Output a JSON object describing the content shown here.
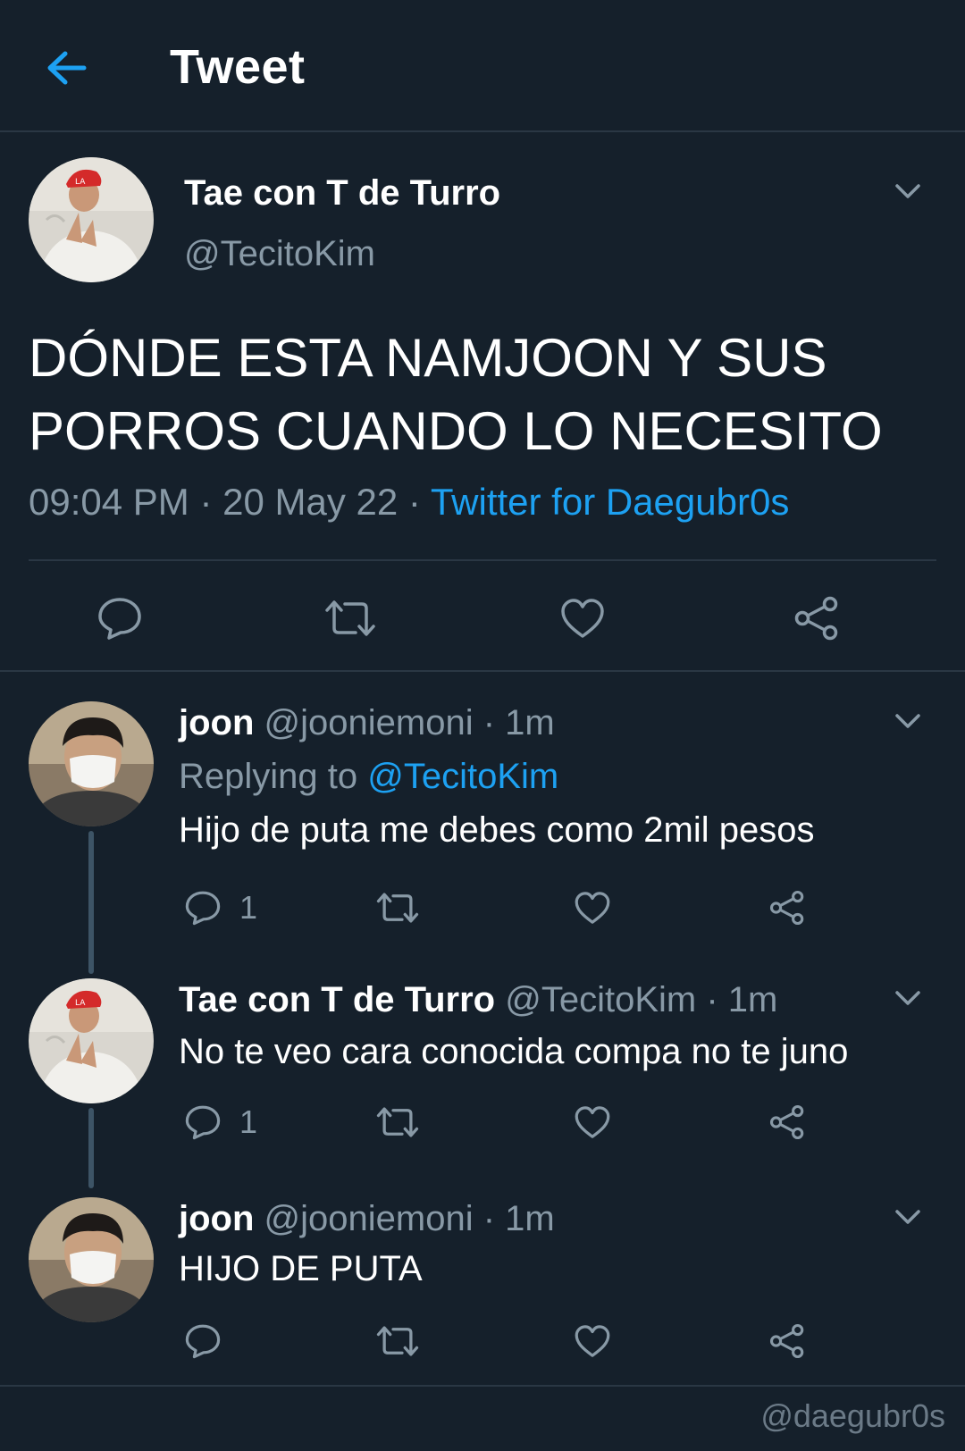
{
  "header": {
    "title": "Tweet"
  },
  "main_tweet": {
    "name": "Tae con T de Turro",
    "handle": "@TecitoKim",
    "text_line1": "DÓNDE ESTA NAMJOON Y SUS",
    "text_line2": "PORROS CUANDO LO NECESITO",
    "time": "09:04 PM",
    "sep1": " · ",
    "date": "20 May 22",
    "sep2": " · ",
    "source": "Twitter for Daegubr0s"
  },
  "replies": [
    {
      "name": "joon",
      "handle": "@jooniemoni",
      "sep": " · ",
      "time": "1m",
      "replying_label": "Replying to ",
      "replying_to": "@TecitoKim",
      "text": "Hijo de puta me debes como 2mil pesos",
      "reply_count": "1"
    },
    {
      "name": "Tae con T de Turro",
      "handle": "@TecitoKim",
      "sep": " · ",
      "time": "1m",
      "text": "No te veo cara conocida compa no te juno",
      "reply_count": "1"
    },
    {
      "name": "joon",
      "handle": "@jooniemoni",
      "sep": " · ",
      "time": "1m",
      "text": "HIJO DE PUTA",
      "reply_count": ""
    }
  ],
  "watermark": "@daegubr0s",
  "colors": {
    "background": "#15202b",
    "accent": "#1da1f2",
    "secondary_text": "#8899a6",
    "divider": "#2a3744"
  },
  "icons": [
    "back-arrow-icon",
    "chevron-down-icon",
    "reply-icon",
    "retweet-icon",
    "like-icon",
    "share-icon"
  ]
}
